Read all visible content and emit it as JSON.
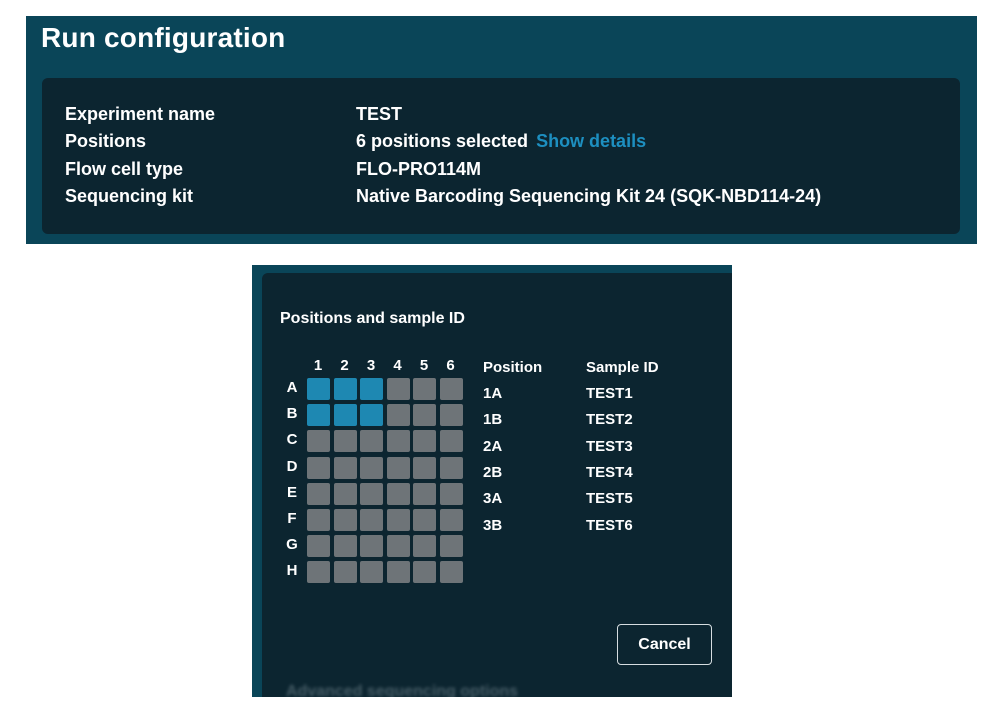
{
  "run": {
    "title": "Run configuration",
    "rows": [
      {
        "label": "Experiment name",
        "value": "TEST"
      },
      {
        "label": "Positions",
        "value": "6 positions selected",
        "link": "Show details"
      },
      {
        "label": "Flow cell type",
        "value": "FLO-PRO114M"
      },
      {
        "label": "Sequencing kit",
        "value": "Native Barcoding Sequencing Kit 24 (SQK-NBD114-24)"
      }
    ]
  },
  "dialog": {
    "title": "Positions and sample ID",
    "grid": {
      "columns": [
        "1",
        "2",
        "3",
        "4",
        "5",
        "6"
      ],
      "rows": [
        "A",
        "B",
        "C",
        "D",
        "E",
        "F",
        "G",
        "H"
      ],
      "selected": [
        "1A",
        "2A",
        "3A",
        "1B",
        "2B",
        "3B"
      ],
      "colors": {
        "selected": "#1e88b2",
        "unselected": "#6e7478"
      }
    },
    "table": {
      "headers": {
        "position": "Position",
        "sample_id": "Sample ID"
      },
      "rows": [
        {
          "position": "1A",
          "sample_id": "TEST1"
        },
        {
          "position": "1B",
          "sample_id": "TEST2"
        },
        {
          "position": "2A",
          "sample_id": "TEST3"
        },
        {
          "position": "2B",
          "sample_id": "TEST4"
        },
        {
          "position": "3A",
          "sample_id": "TEST5"
        },
        {
          "position": "3B",
          "sample_id": "TEST6"
        }
      ]
    },
    "cancel_label": "Cancel",
    "background_hint": "Advanced sequencing options"
  }
}
